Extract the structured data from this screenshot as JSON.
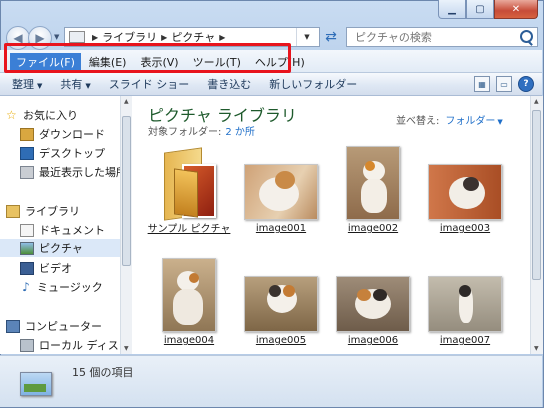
{
  "nav": {
    "breadcrumb": [
      "ライブラリ",
      "ピクチャ"
    ],
    "search_placeholder": "ピクチャの検索"
  },
  "menubar": {
    "items": [
      {
        "label": "ファイル(F)",
        "active": true
      },
      {
        "label": "編集(E)"
      },
      {
        "label": "表示(V)"
      },
      {
        "label": "ツール(T)"
      },
      {
        "label": "ヘルプ(H)"
      }
    ]
  },
  "toolbar": {
    "organize": "整理",
    "share": "共有",
    "slideshow": "スライド ショー",
    "burn": "書き込む",
    "new_folder": "新しいフォルダー"
  },
  "sidebar": {
    "favorites": "お気に入り",
    "downloads": "ダウンロード",
    "desktop": "デスクトップ",
    "recent": "最近表示した場所",
    "libraries": "ライブラリ",
    "documents": "ドキュメント",
    "pictures": "ピクチャ",
    "videos": "ビデオ",
    "music": "ミュージック",
    "computer": "コンピューター",
    "local_disk": "ローカル ディスク"
  },
  "main": {
    "title": "ピクチャ ライブラリ",
    "subtitle_label": "対象フォルダー:",
    "subtitle_link": "2 か所",
    "sort_label": "並べ替え:",
    "sort_value": "フォルダー",
    "items": [
      {
        "name": "サンプル ピクチャ",
        "kind": "folder"
      },
      {
        "name": "image001",
        "kind": "photo"
      },
      {
        "name": "image002",
        "kind": "photo"
      },
      {
        "name": "image003",
        "kind": "photo"
      },
      {
        "name": "image004",
        "kind": "photo"
      },
      {
        "name": "image005",
        "kind": "photo"
      },
      {
        "name": "image006",
        "kind": "photo"
      },
      {
        "name": "image007",
        "kind": "photo"
      }
    ]
  },
  "status": {
    "count_text": "15 個の項目"
  },
  "colors": {
    "highlight": "#e8141d",
    "menu_active": "#3b7fd6",
    "link": "#1f6fc9",
    "title_green": "#1e5a2c"
  }
}
